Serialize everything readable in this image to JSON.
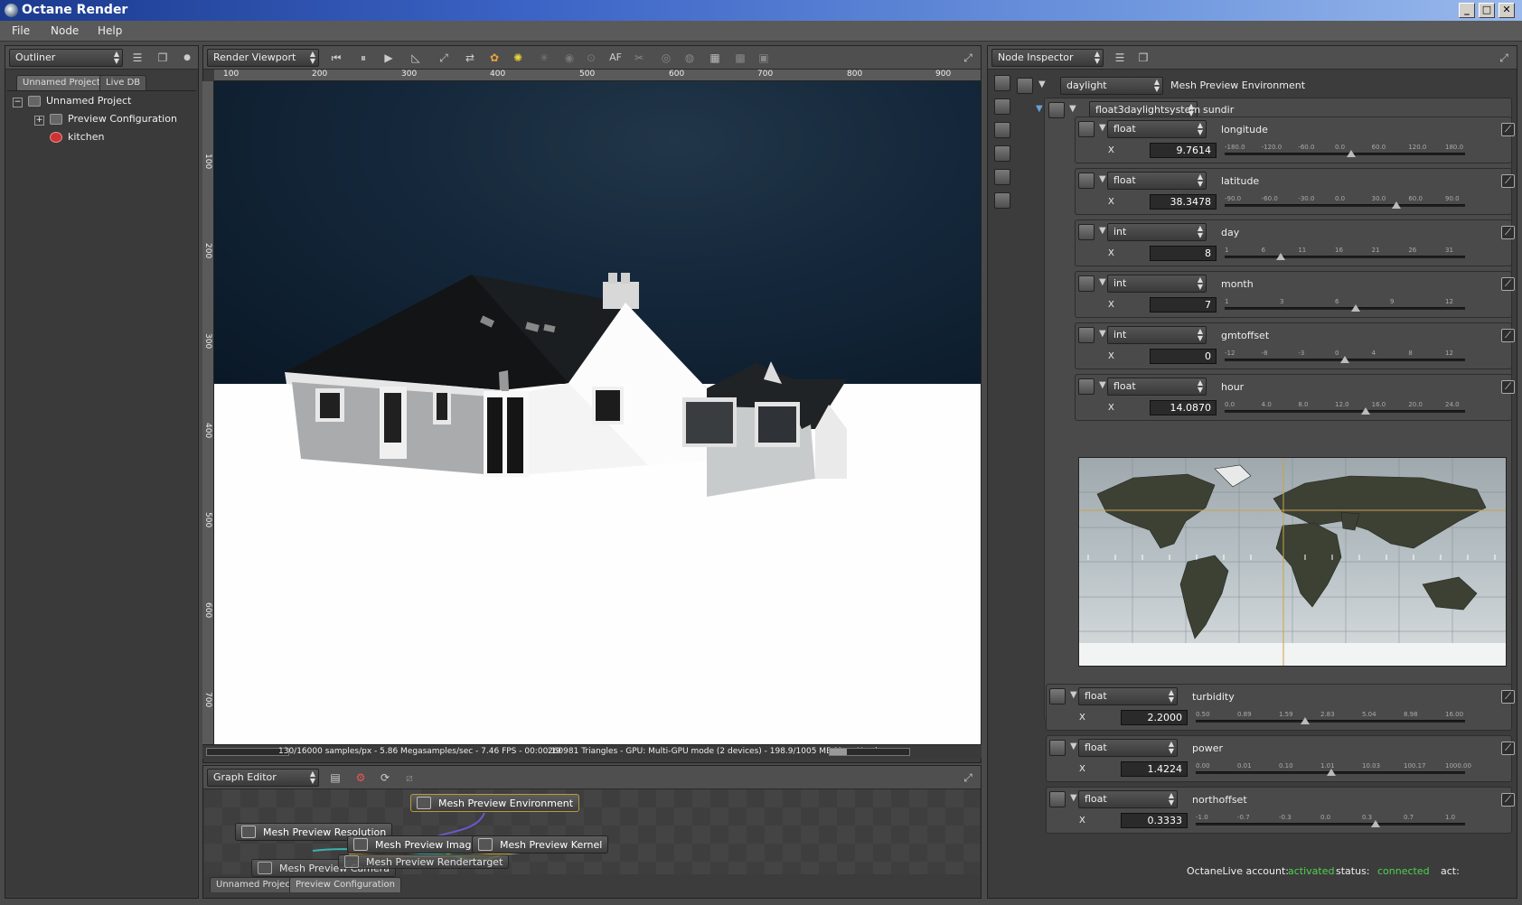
{
  "app": {
    "title": "Octane Render"
  },
  "window_controls": [
    "_",
    "□",
    "✕"
  ],
  "menu": [
    "File",
    "Node",
    "Help"
  ],
  "outliner": {
    "panel_label": "Outliner",
    "tabs": [
      "Unnamed Project",
      "Live DB"
    ],
    "tree": [
      {
        "label": "Unnamed Project",
        "level": 0,
        "expander": "−"
      },
      {
        "label": "Preview Configuration",
        "level": 1,
        "expander": "+"
      },
      {
        "label": "kitchen",
        "level": 1,
        "expander": ""
      }
    ]
  },
  "viewport": {
    "panel_label": "Render Viewport",
    "toolbar_af": "AF",
    "ruler_h": [
      "100",
      "200",
      "300",
      "400",
      "500",
      "600",
      "700",
      "800",
      "900"
    ],
    "ruler_v": [
      "100",
      "200",
      "300",
      "400",
      "500",
      "600",
      "700"
    ],
    "status_left": "130/16000 samples/px - 5.86 Megasamples/sec - 7.46 FPS - 00:00:19",
    "status_right": "260981 Triangles - GPU: Multi-GPU mode (2 devices) - 198.9/1005 MB Mem Used"
  },
  "graph_editor": {
    "panel_label": "Graph Editor",
    "nodes": [
      "Mesh Preview Environment",
      "Mesh Preview Resolution",
      "Mesh Preview Camera",
      "Mesh Preview Imager",
      "Mesh Preview Kernel",
      "Mesh Preview Rendertarget"
    ],
    "tabs": [
      "Unnamed Project",
      "Preview Configuration"
    ]
  },
  "node_inspector": {
    "panel_label": "Node Inspector",
    "root": {
      "type": "daylight",
      "name": "Mesh Preview Environment"
    },
    "sundir": {
      "type": "float3daylightsystem",
      "name": "sundir"
    },
    "params": [
      {
        "type": "float",
        "name": "longitude",
        "axis": "X",
        "value": "9.7614",
        "ticks": [
          "-180.0",
          "-120.0",
          "-60.0",
          "0.0",
          "60.0",
          "120.0",
          "180.0"
        ],
        "pos": 0.527
      },
      {
        "type": "float",
        "name": "latitude",
        "axis": "X",
        "value": "38.3478",
        "ticks": [
          "-90.0",
          "-60.0",
          "-30.0",
          "0.0",
          "30.0",
          "60.0",
          "90.0"
        ],
        "pos": 0.713
      },
      {
        "type": "int",
        "name": "day",
        "axis": "X",
        "value": "8",
        "ticks": [
          "1",
          "6",
          "11",
          "16",
          "21",
          "26",
          "31"
        ],
        "pos": 0.233
      },
      {
        "type": "int",
        "name": "month",
        "axis": "X",
        "value": "7",
        "ticks": [
          "1",
          "3",
          "6",
          "9",
          "12"
        ],
        "pos": 0.545
      },
      {
        "type": "int",
        "name": "gmtoffset",
        "axis": "X",
        "value": "0",
        "ticks": [
          "-12",
          "-8",
          "-3",
          "0",
          "4",
          "8",
          "12"
        ],
        "pos": 0.5
      },
      {
        "type": "float",
        "name": "hour",
        "axis": "X",
        "value": "14.0870",
        "ticks": [
          "0.0",
          "4.0",
          "8.0",
          "12.0",
          "16.0",
          "20.0",
          "24.0"
        ],
        "pos": 0.587
      }
    ],
    "extra": [
      {
        "type": "float",
        "name": "turbidity",
        "axis": "X",
        "value": "2.2000",
        "ticks": [
          "0.50",
          "0.89",
          "1.59",
          "2.83",
          "5.04",
          "8.98",
          "16.00"
        ],
        "pos": 0.405
      },
      {
        "type": "float",
        "name": "power",
        "axis": "X",
        "value": "1.4224",
        "ticks": [
          "0.00",
          "0.01",
          "0.10",
          "1.01",
          "10.03",
          "100.17",
          "1000.00"
        ],
        "pos": 0.505
      },
      {
        "type": "float",
        "name": "northoffset",
        "axis": "X",
        "value": "0.3333",
        "ticks": [
          "-1.0",
          "-0.7",
          "-0.3",
          "0.0",
          "0.3",
          "0.7",
          "1.0"
        ],
        "pos": 0.667
      }
    ]
  },
  "status": {
    "account_label": "OctaneLive account:",
    "account_value": "activated",
    "status_label": "status:",
    "status_value": "connected",
    "act_label": "act:",
    "ok_color": "#4ed24e"
  }
}
